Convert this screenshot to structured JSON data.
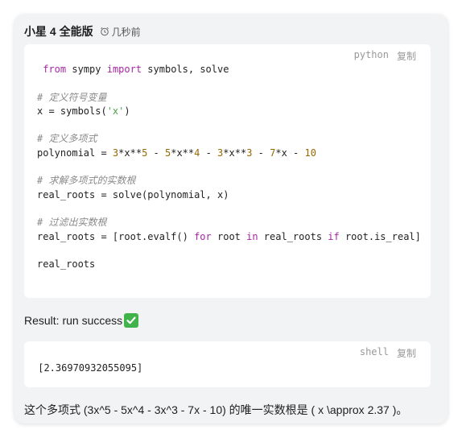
{
  "header": {
    "sender": "小星 4 全能版",
    "time": "几秒前"
  },
  "code_block": {
    "language": "python",
    "copy_label": "复制",
    "lines": [
      [
        {
          "t": " "
        },
        {
          "t": "from",
          "c": "kw"
        },
        {
          "t": " sympy "
        },
        {
          "t": "import",
          "c": "kw"
        },
        {
          "t": " symbols, solve"
        }
      ],
      [],
      [
        {
          "t": "# 定义符号变量",
          "c": "cmt"
        }
      ],
      [
        {
          "t": "x = symbols("
        },
        {
          "t": "'x'",
          "c": "str"
        },
        {
          "t": ")"
        }
      ],
      [],
      [
        {
          "t": "# 定义多项式",
          "c": "cmt"
        }
      ],
      [
        {
          "t": "polynomial = "
        },
        {
          "t": "3",
          "c": "num"
        },
        {
          "t": "*x**"
        },
        {
          "t": "5",
          "c": "num"
        },
        {
          "t": " - "
        },
        {
          "t": "5",
          "c": "num"
        },
        {
          "t": "*x**"
        },
        {
          "t": "4",
          "c": "num"
        },
        {
          "t": " - "
        },
        {
          "t": "3",
          "c": "num"
        },
        {
          "t": "*x**"
        },
        {
          "t": "3",
          "c": "num"
        },
        {
          "t": " - "
        },
        {
          "t": "7",
          "c": "num"
        },
        {
          "t": "*x - "
        },
        {
          "t": "10",
          "c": "num"
        }
      ],
      [],
      [
        {
          "t": "# 求解多项式的实数根",
          "c": "cmt"
        }
      ],
      [
        {
          "t": "real_roots = solve(polynomial, x)"
        }
      ],
      [],
      [
        {
          "t": "# 过滤出实数根",
          "c": "cmt"
        }
      ],
      [
        {
          "t": "real_roots = [root.evalf() "
        },
        {
          "t": "for",
          "c": "kw"
        },
        {
          "t": " root "
        },
        {
          "t": "in",
          "c": "kw"
        },
        {
          "t": " real_roots "
        },
        {
          "t": "if",
          "c": "kw"
        },
        {
          "t": " root.is_real]"
        }
      ],
      [],
      [
        {
          "t": "real_roots"
        }
      ]
    ]
  },
  "result": {
    "text": "Result: run success",
    "status_icon": "check-mark-icon",
    "status_color": "#40b34a"
  },
  "output_block": {
    "language": "shell",
    "copy_label": "复制",
    "output": " [2.36970932055095]"
  },
  "answer": "这个多项式 (3x^5 - 5x^4 - 3x^3 - 7x - 10) 的唯一实数根是 ( x \\approx 2.37 )。"
}
